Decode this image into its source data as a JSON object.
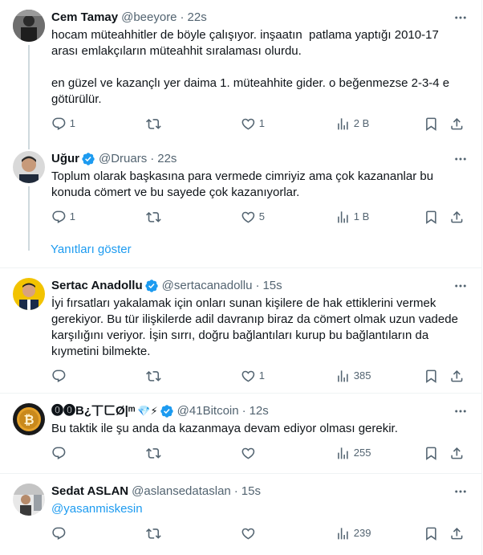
{
  "tweets": [
    {
      "name": "Cem Tamay",
      "handle": "@beeyore",
      "time": "22s",
      "verified": false,
      "text": "hocam müteahhitler de böyle çalışıyor. inşaatın  patlama yaptığı 2010-17 arası emlakçıların müteahhit sıralaması olurdu.\n\nen güzel ve kazançlı yer daima 1. müteahhite gider. o beğenmezse 2-3-4 e götürülür.",
      "replies": "1",
      "retweets": "",
      "likes": "1",
      "views": "2 B"
    },
    {
      "name": "Uğur",
      "handle": "@Druars",
      "time": "22s",
      "verified": true,
      "text": "Toplum olarak başkasına para vermede cimriyiz ama çok kazananlar bu konuda cömert ve bu sayede çok kazanıyorlar.",
      "replies": "1",
      "retweets": "",
      "likes": "5",
      "views": "1 B"
    },
    {
      "name": "Sertac Anadollu",
      "handle": "@sertacanadollu",
      "time": "15s",
      "verified": true,
      "text": "İyi fırsatları yakalamak için onları sunan kişilere de hak ettiklerini vermek gerekiyor. Bu tür ilişkilerde adil davranıp biraz da cömert olmak uzun vadede karşılığını veriyor. İşin sırrı, doğru bağlantıları kurup bu bağlantıların da kıymetini bilmekte.",
      "replies": "",
      "retweets": "",
      "likes": "1",
      "views": "385"
    },
    {
      "name": "⓿⓿B¿丅ㄈØ|ᵐ",
      "name_emoji": "💎⚡",
      "handle": "@41Bitcoin",
      "time": "12s",
      "verified": true,
      "text": "Bu taktik ile şu anda da kazanmaya devam ediyor olması gerekir.",
      "replies": "",
      "retweets": "",
      "likes": "",
      "views": "255"
    },
    {
      "name": "Sedat ASLAN",
      "handle": "@aslansedataslan",
      "time": "15s",
      "verified": false,
      "text": "@yasanmiskesin",
      "replies": "",
      "retweets": "",
      "likes": "",
      "views": "239"
    }
  ],
  "show_replies": "Yanıtları göster",
  "colors": {
    "accent": "#1d9bf0",
    "secondary_text": "#536471",
    "border": "#eff3f4",
    "thread_line": "#cfd9de"
  }
}
